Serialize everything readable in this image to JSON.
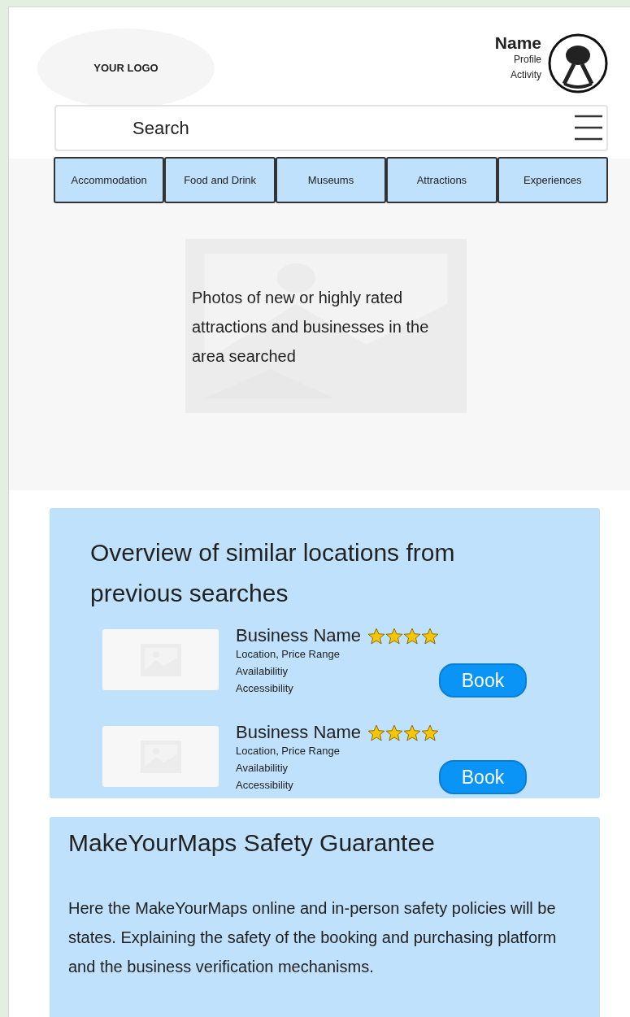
{
  "header": {
    "logo": "YOUR LOGO",
    "profile": {
      "name": "Name",
      "links": [
        "Profile",
        "Activity"
      ]
    }
  },
  "search": {
    "placeholder": "Search"
  },
  "categories": [
    {
      "label": "Accommodation"
    },
    {
      "label": "Food and Drink"
    },
    {
      "label": "Museums"
    },
    {
      "label": "Attractions"
    },
    {
      "label": "Experiences"
    }
  ],
  "hero": {
    "text": "Photos of new or highly rated attractions and businesses in the area searched"
  },
  "overview": {
    "title": "Overview of similar locations from previous searches",
    "listings": [
      {
        "name": "Business Name",
        "stars": 4,
        "details": [
          "Location, Price Range",
          "Availabilitiy",
          "Accessibility"
        ],
        "button": "Book"
      },
      {
        "name": "Business Name",
        "stars": 4,
        "details": [
          "Location, Price Range",
          "Availabilitiy",
          "Accessibility"
        ],
        "button": "Book"
      }
    ]
  },
  "safety": {
    "title": "MakeYourMaps Safety Guarantee",
    "text": "Here the MakeYourMaps online and in-person safety policies will be states. Explaining the safety of the booking and purchasing platform and the business verification mechanisms."
  }
}
